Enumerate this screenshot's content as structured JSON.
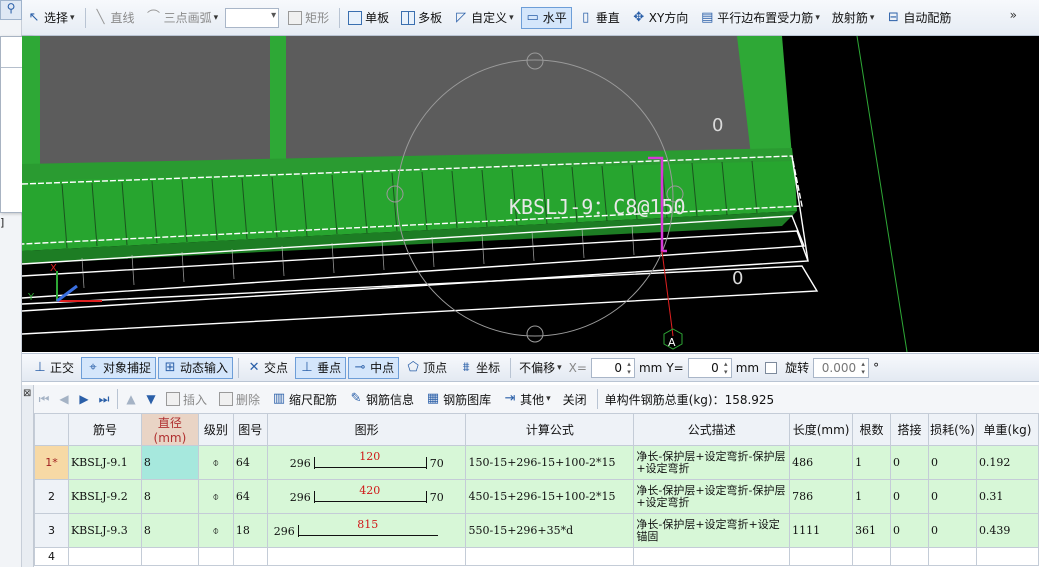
{
  "toolbar": {
    "select": "选择",
    "line": "直线",
    "arc": "三点画弧",
    "rect": "矩形",
    "single": "单板",
    "multi": "多板",
    "custom": "自定义",
    "horizontal": "水平",
    "vertical": "垂直",
    "xy": "XY方向",
    "parallel": "平行边布置受力筋",
    "radial": "放射筋",
    "auto": "自动配筋",
    "more": "»"
  },
  "left": {
    "bracket": "]"
  },
  "viewport": {
    "label": "KBSLJ-9：C8@150",
    "num_top": "0",
    "num_bottom": "0",
    "axis_x": "X",
    "axis_y": "Y",
    "point_a": "A"
  },
  "snap": {
    "ortho": "正交",
    "osnap": "对象捕捉",
    "dyn": "动态输入",
    "intersect": "交点",
    "perp": "垂点",
    "mid": "中点",
    "vertex": "顶点",
    "coord": "坐标",
    "offset": "不偏移",
    "x_label": "X=",
    "x_value": "0",
    "unit1": "mm",
    "y_label": "Y=",
    "y_value": "0",
    "unit2": "mm",
    "rotate": "旋转",
    "rotate_value": "0.000",
    "deg": "°"
  },
  "gridbar": {
    "insert": "插入",
    "delete": "删除",
    "scale": "缩尺配筋",
    "info": "钢筋信息",
    "library": "钢筋图库",
    "other": "其他",
    "close": "关闭",
    "total": "单构件钢筋总重(kg)：158.925"
  },
  "table": {
    "headers": [
      "",
      "筋号",
      "直径(mm)",
      "级别",
      "图号",
      "图形",
      "计算公式",
      "公式描述",
      "长度(mm)",
      "根数",
      "搭接",
      "损耗(%)",
      "单重(kg)"
    ],
    "rows": [
      {
        "no": "1*",
        "name": "KBSLJ-9.1",
        "dia": "8",
        "grade": "⌽",
        "fig": "64",
        "shape_left": "296",
        "shape_mid": "120",
        "shape_right": "70",
        "formula": "150-15+296-15+100-2*15",
        "desc": "净长-保护层+设定弯折-保护层+设定弯折",
        "length": "486",
        "count": "1",
        "lap": "0",
        "loss": "0",
        "weight": "0.192"
      },
      {
        "no": "2",
        "name": "KBSLJ-9.2",
        "dia": "8",
        "grade": "⌽",
        "fig": "64",
        "shape_left": "296",
        "shape_mid": "420",
        "shape_right": "70",
        "formula": "450-15+296-15+100-2*15",
        "desc": "净长-保护层+设定弯折-保护层+设定弯折",
        "length": "786",
        "count": "1",
        "lap": "0",
        "loss": "0",
        "weight": "0.31"
      },
      {
        "no": "3",
        "name": "KBSLJ-9.3",
        "dia": "8",
        "grade": "⌽",
        "fig": "18",
        "shape_left": "296",
        "shape_mid": "815",
        "shape_right": "",
        "formula": "550-15+296+35*d",
        "desc": "净长-保护层+设定弯折+设定锚固",
        "length": "1111",
        "count": "361",
        "lap": "0",
        "loss": "0",
        "weight": "0.439"
      },
      {
        "no": "4",
        "name": "",
        "dia": "",
        "grade": "",
        "fig": "",
        "shape_left": "",
        "shape_mid": "",
        "shape_right": "",
        "formula": "",
        "desc": "",
        "length": "",
        "count": "",
        "lap": "",
        "loss": "",
        "weight": ""
      }
    ]
  },
  "colors": {
    "green": "#2ea836",
    "accent": "#6d9ed8",
    "selected_row": "#d7f7d7",
    "highlight_cell": "#a6e8dd",
    "rebar": "#d83ad8"
  }
}
